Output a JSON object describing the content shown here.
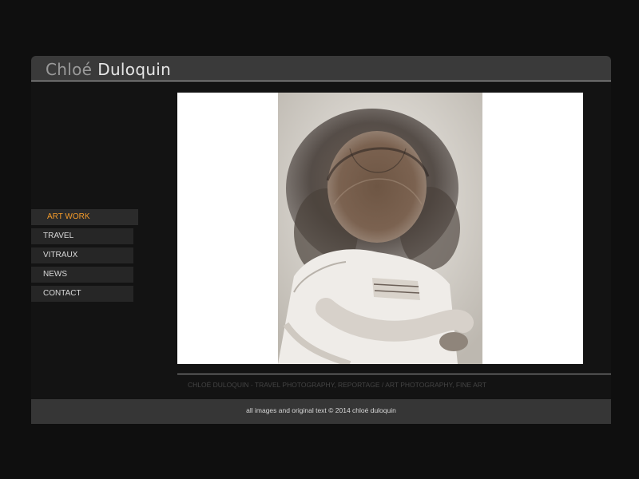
{
  "header": {
    "brand_first": "Chloé",
    "brand_last": "Duloquin"
  },
  "nav": {
    "items": [
      {
        "label": "ART WORK",
        "active": true
      },
      {
        "label": "TRAVEL",
        "active": false
      },
      {
        "label": "VITRAUX",
        "active": false
      },
      {
        "label": "NEWS",
        "active": false
      },
      {
        "label": "CONTACT",
        "active": false
      }
    ]
  },
  "main": {
    "tagline": "CHLOÉ DULOQUIN - TRAVEL PHOTOGRAPHY, REPORTAGE / ART PHOTOGRAPHY, FINE ART"
  },
  "footer": {
    "copyright": "all images and original text © 2014 chloé duloquin"
  },
  "colors": {
    "page_background": "#0f0f0f",
    "header_background": "#3a3a3a",
    "nav_background": "#262626",
    "nav_active_text": "#f39a2a",
    "nav_text": "#d9d9d9",
    "footer_background": "#363636"
  }
}
